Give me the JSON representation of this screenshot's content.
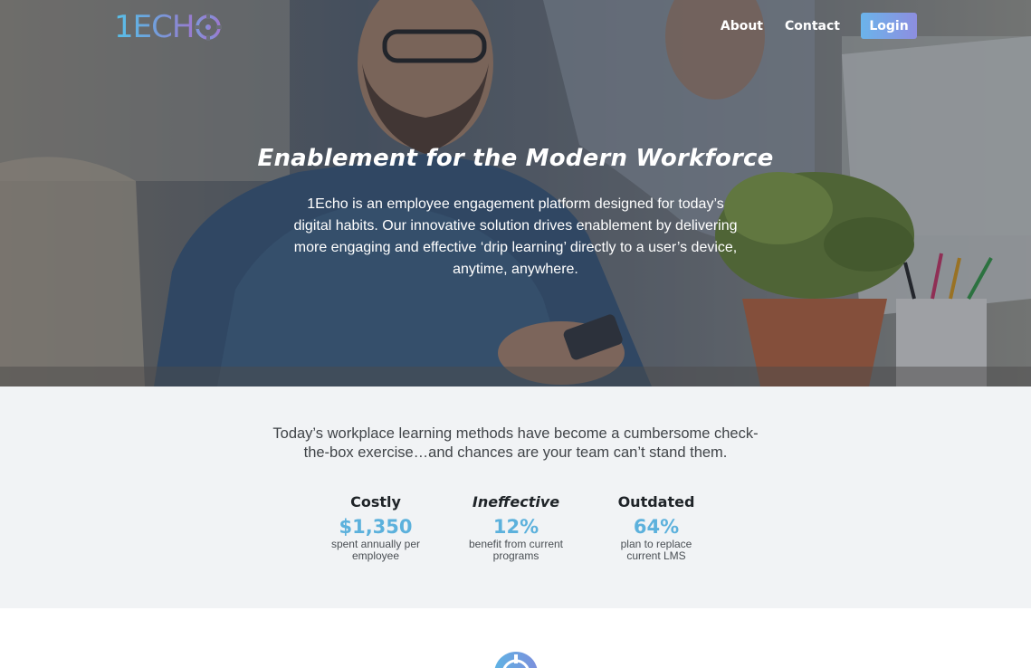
{
  "brand": {
    "logo_text": "1ECH",
    "accent_start": "#56c2ea",
    "accent_end": "#9a7ad0"
  },
  "nav": {
    "about": "About",
    "contact": "Contact",
    "login": "Login"
  },
  "hero": {
    "title": "Enablement for the Modern Workforce",
    "description": "1Echo is an employee engagement platform designed for today’s digital habits. Our innovative solution drives enablement by delivering more engaging and effective ‘drip learning’ directly to a user’s device, anytime, anywhere."
  },
  "stats": {
    "intro": "Today’s workplace learning methods have become a cumbersome check-the-box exercise…and chances are your team can’t stand them.",
    "items": [
      {
        "heading": "Costly",
        "value": "$1,350",
        "desc": "spent annually per employee"
      },
      {
        "heading": "Ineffective",
        "value": "12%",
        "desc": "benefit from current programs"
      },
      {
        "heading": "Outdated",
        "value": "64%",
        "desc": "plan to replace current LMS"
      }
    ],
    "value_color": "#5cb1dc"
  },
  "icons": {
    "logo_mark": "echo-circle-icon",
    "section_icon": "compass-icon"
  }
}
